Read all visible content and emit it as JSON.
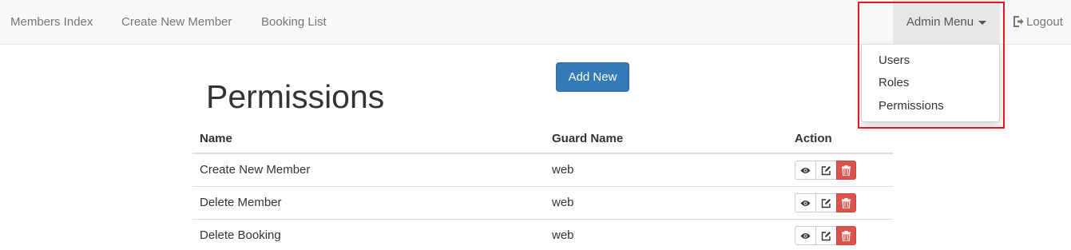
{
  "nav": {
    "links": [
      "Members Index",
      "Create New Member",
      "Booking List"
    ],
    "admin_menu": "Admin Menu",
    "logout": "Logout"
  },
  "dropdown": {
    "items": [
      "Users",
      "Roles",
      "Permissions"
    ]
  },
  "page": {
    "title": "Permissions",
    "add_button": "Add New"
  },
  "table": {
    "headers": [
      "Name",
      "Guard Name",
      "Action"
    ],
    "rows": [
      {
        "name": "Create New Member",
        "guard": "web"
      },
      {
        "name": "Delete Member",
        "guard": "web"
      },
      {
        "name": "Delete Booking",
        "guard": "web"
      }
    ]
  },
  "colors": {
    "primary": "#337ab7",
    "danger": "#d9534f",
    "highlight": "#e8161c"
  }
}
